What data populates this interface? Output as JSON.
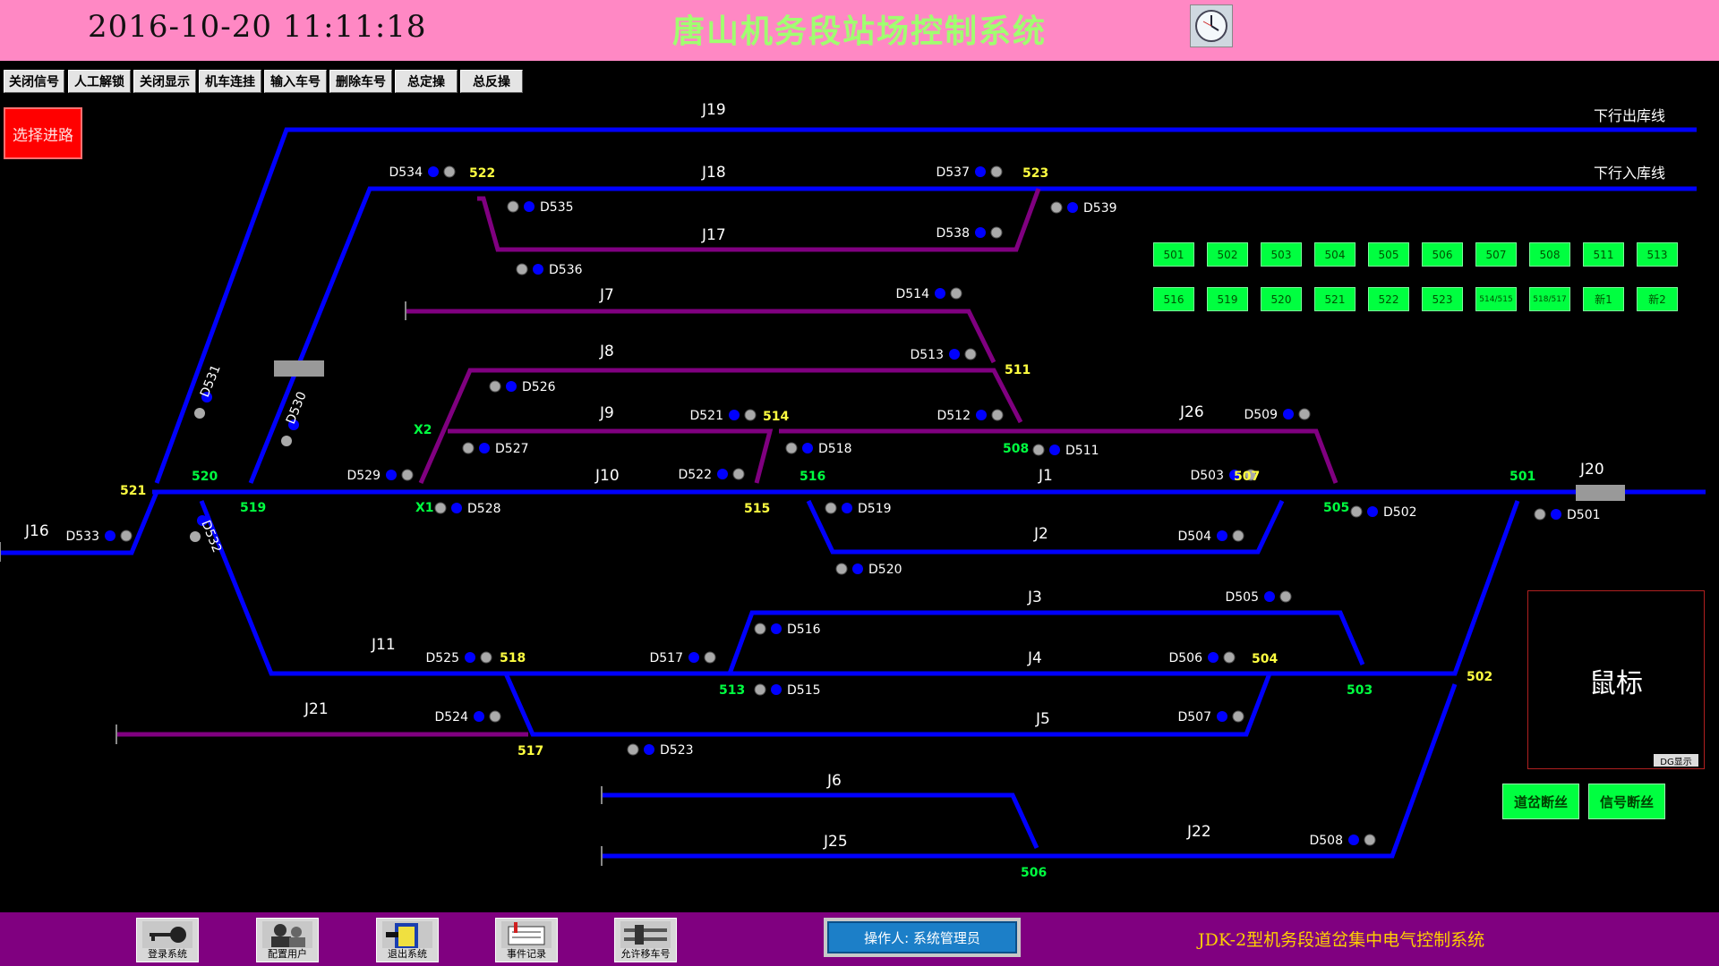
{
  "header": {
    "datetime": "2016-10-20 11:11:18",
    "title": "唐山机务段站场控制系统"
  },
  "toolbar": [
    "关闭信号",
    "人工解锁",
    "关闭显示",
    "机车连挂",
    "输入车号",
    "删除车号",
    "总定操",
    "总反操"
  ],
  "route_button": "选择进路",
  "direction_labels": {
    "out": "下行出库线",
    "in": "下行入库线"
  },
  "track_labels": [
    "J19",
    "J18",
    "J17",
    "J7",
    "J8",
    "J9",
    "J10",
    "J1",
    "J26",
    "J20",
    "J16",
    "J2",
    "J3",
    "J4",
    "J5",
    "J11",
    "J21",
    "J6",
    "J25",
    "J22"
  ],
  "signals": [
    "D534",
    "D535",
    "D536",
    "D537",
    "D538",
    "D539",
    "D514",
    "D513",
    "D526",
    "D527",
    "D529",
    "D528",
    "D521",
    "D522",
    "D518",
    "D519",
    "D520",
    "D512",
    "D511",
    "D509",
    "D503",
    "D502",
    "D501",
    "D504",
    "D505",
    "D506",
    "D507",
    "D508",
    "D516",
    "D517",
    "D515",
    "D525",
    "D524",
    "D523",
    "D533",
    "D531",
    "D530",
    "D532"
  ],
  "switch_labels": {
    "yellow": [
      "522",
      "523",
      "521",
      "511",
      "514",
      "515",
      "518",
      "517",
      "507",
      "504",
      "502"
    ],
    "green": [
      "520",
      "519",
      "X1",
      "X2",
      "516",
      "508",
      "505",
      "501",
      "513",
      "503",
      "506"
    ]
  },
  "switch_panel": {
    "row1": [
      "501",
      "502",
      "503",
      "504",
      "505",
      "506",
      "507",
      "508",
      "511",
      "513"
    ],
    "row2": [
      "516",
      "519",
      "520",
      "521",
      "522",
      "523",
      "514/515",
      "518/517",
      "新1",
      "新2"
    ]
  },
  "mouse_box": {
    "label": "鼠标",
    "dg_button": "DG显示"
  },
  "fault_buttons": [
    "道岔断丝",
    "信号断丝"
  ],
  "footer": {
    "buttons": [
      "登录系统",
      "配置用户",
      "退出系统",
      "事件记录",
      "允许移车号"
    ],
    "operator": "操作人: 系统管理员",
    "system_name": "JDK-2型机务段道岔集中电气控制系统"
  },
  "colors": {
    "header_bg": "#ff88c4",
    "title": "#a0ff70",
    "track_blue": "#0000ff",
    "track_purple": "#800080",
    "signal_blue": "#0000ff",
    "switch_yellow": "#ffff40",
    "switch_green": "#00ff40",
    "footer_bg": "#800080"
  }
}
